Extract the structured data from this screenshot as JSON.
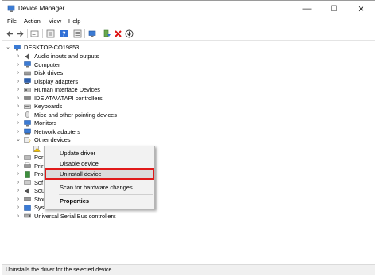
{
  "window": {
    "title": "Device Manager",
    "minimize": "—",
    "maximize": "☐",
    "close": "✕"
  },
  "menu": [
    "File",
    "Action",
    "View",
    "Help"
  ],
  "toolbar": {
    "icons": [
      "back-icon",
      "forward-icon",
      "properties-icon",
      "show-hidden-icon",
      "help-icon",
      "view-icon",
      "scan-hardware-icon",
      "update-driver-icon",
      "uninstall-icon",
      "download-icon"
    ]
  },
  "tree": {
    "root": "DESKTOP-CO19853",
    "categories": [
      "Audio inputs and outputs",
      "Computer",
      "Disk drives",
      "Display adapters",
      "Human Interface Devices",
      "IDE ATA/ATAPI controllers",
      "Keyboards",
      "Mice and other pointing devices",
      "Monitors",
      "Network adapters",
      "Other devices"
    ],
    "partial_rows": [
      "Por",
      "Prir",
      "Pro",
      "Sof",
      "Sou",
      "Stor"
    ],
    "tail": [
      "System devices",
      "Universal Serial Bus controllers"
    ]
  },
  "context_menu": {
    "items": [
      "Update driver",
      "Disable device",
      "Uninstall device",
      "Scan for hardware changes",
      "Properties"
    ]
  },
  "status": "Uninstalls the driver for the selected device.",
  "colors": {
    "highlight_outline": "#e01a1a",
    "menu_bg": "#f2f2f2"
  }
}
